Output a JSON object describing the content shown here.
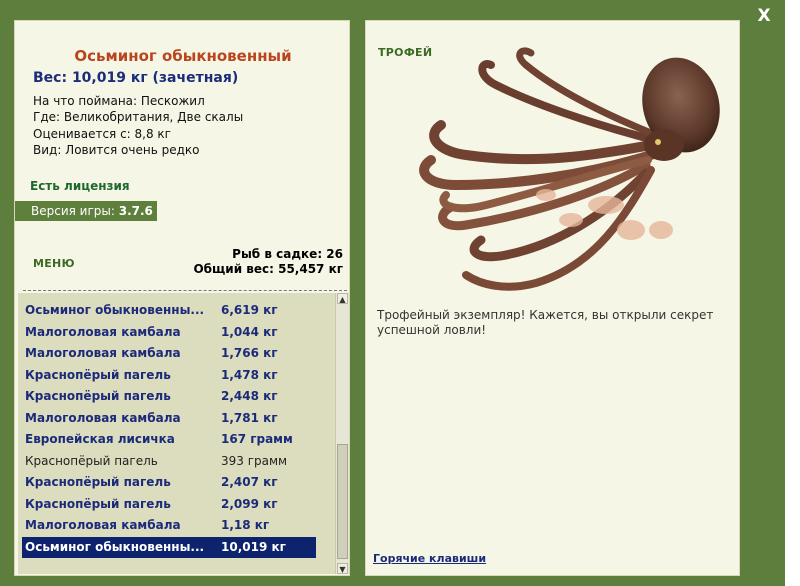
{
  "window": {
    "close_label": "X"
  },
  "fish": {
    "name": "Осьминог обыкновенный",
    "weight_line": "Вес: 10,019 кг (зачетная)",
    "caught_on": "На что поймана: Пескожил",
    "location": "Где: Великобритания, Две скалы",
    "valued_from": "Оценивается с: 8,8 кг",
    "rarity": "Вид: Ловится очень редко"
  },
  "license": "Есть лицензия",
  "version": {
    "label": "Версия игры:",
    "value": "3.7.6"
  },
  "menu_label": "МЕНЮ",
  "cage": {
    "count_line": "Рыб в садке: 26",
    "total_line": "Общий вес: 55,457 кг"
  },
  "catch_list": [
    {
      "name": "Осьминог обыкновенны...",
      "weight": "6,619 кг",
      "style": "bold"
    },
    {
      "name": "Малоголовая камбала",
      "weight": "1,044 кг",
      "style": "bold"
    },
    {
      "name": "Малоголовая камбала",
      "weight": "1,766 кг",
      "style": "bold"
    },
    {
      "name": "Краснопёрый пагель",
      "weight": "1,478 кг",
      "style": "bold"
    },
    {
      "name": "Краснопёрый пагель",
      "weight": "2,448 кг",
      "style": "bold"
    },
    {
      "name": "Малоголовая камбала",
      "weight": "1,781 кг",
      "style": "bold"
    },
    {
      "name": "Европейская лисичка",
      "weight": "167 грамм",
      "style": "bold"
    },
    {
      "name": "Краснопёрый пагель",
      "weight": "393 грамм",
      "style": "plain"
    },
    {
      "name": "Краснопёрый пагель",
      "weight": "2,407 кг",
      "style": "bold"
    },
    {
      "name": "Краснопёрый пагель",
      "weight": "2,099 кг",
      "style": "bold"
    },
    {
      "name": "Малоголовая камбала",
      "weight": "1,18 кг",
      "style": "bold"
    },
    {
      "name": "Осьминог обыкновенны...",
      "weight": "10,019 кг",
      "style": "selected"
    }
  ],
  "scrollbar": {
    "up_icon": "arrow-up-icon",
    "down_icon": "arrow-down-icon"
  },
  "trophy": {
    "title": "ТРОФЕЙ",
    "image_icon": "octopus-image",
    "message": "Трофейный экземпляр! Кажется, вы открыли секрет успешной ловли!"
  },
  "hotkeys_label": "Горячие клавиши",
  "colors": {
    "frame": "#5d7e3c",
    "panel": "#f6f6e6",
    "list_bg": "#dcdcbe",
    "selected": "#0d236e",
    "title": "#b9451f",
    "navy": "#1b2b7a",
    "green_text": "#1d6a2c"
  }
}
